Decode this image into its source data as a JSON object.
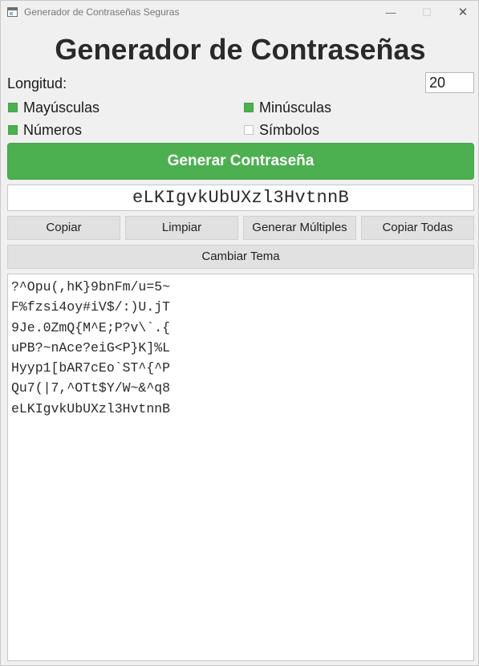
{
  "window": {
    "title": "Generador de Contraseñas Seguras",
    "minimize_glyph": "—",
    "maximize_glyph": "☐",
    "close_glyph": "✕"
  },
  "header": {
    "title": "Generador de Contraseñas"
  },
  "length": {
    "label": "Longitud:",
    "value": "20"
  },
  "options": {
    "uppercase": {
      "label": "Mayúsculas",
      "checked": true
    },
    "lowercase": {
      "label": "Minúsculas",
      "checked": true
    },
    "numbers": {
      "label": "Números",
      "checked": true
    },
    "symbols": {
      "label": "Símbolos",
      "checked": false
    }
  },
  "generate_button": {
    "label": "Generar Contraseña"
  },
  "password_display": {
    "value": "eLKIgvkUbUXzl3HvtnnB"
  },
  "actions": {
    "copy": "Copiar",
    "clear": "Limpiar",
    "generate_multiple": "Generar Múltiples",
    "copy_all": "Copiar Todas"
  },
  "theme_button": {
    "label": "Cambiar Tema"
  },
  "output": {
    "lines": [
      "?^Opu(,hK}9bnFm/u=5~",
      "F%fzsi4oy#iV$/:)U.jT",
      "9Je.0ZmQ{M^E;P?v\\`.{",
      "uPB?~nAce?eiG<P}K]%L",
      "Hyyp1[bAR7cEo`ST^{^P",
      "Qu7(|7,^OTt$Y/W~&^q8",
      "eLKIgvkUbUXzl3HvtnnB"
    ]
  },
  "colors": {
    "accent": "#4caf50",
    "background": "#f0f0f0",
    "button": "#e1e1e1"
  }
}
